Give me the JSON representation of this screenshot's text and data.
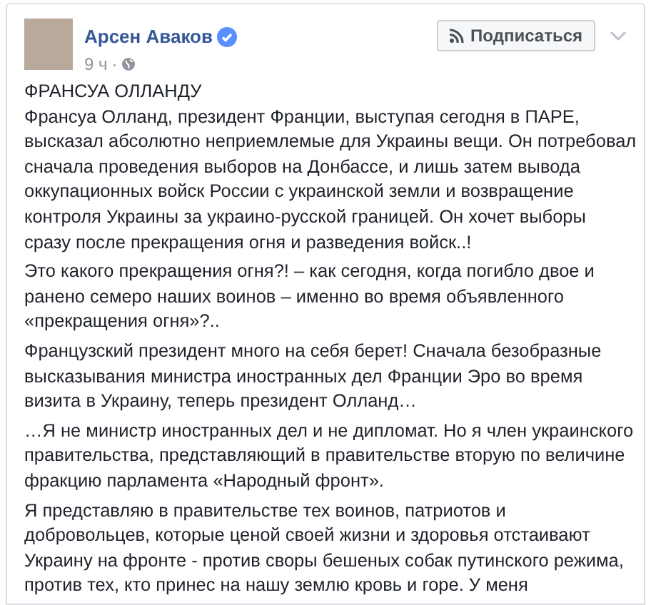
{
  "post": {
    "author": "Арсен Аваков",
    "verified": true,
    "time": "9 ч",
    "separator": "·",
    "follow_button": "Подписаться",
    "title": "ФРАНСУА ОЛЛАНДУ",
    "paragraphs": [
      "Франсуа Олланд, президент Франции, выступая сегодня в ПАРЕ, высказал абсолютно неприемлемые для Украины вещи. Он потребовал сначала проведения выборов на Донбассе, и лишь затем вывода оккупационных войск России с украинской земли и возвращение контроля Украины за украино-русской границей. Он хочет выборы сразу после прекращения огня и разведения войск..!",
      "Это какого прекращения огня?! – как сегодня, когда погибло двое и ранено семеро наших воинов – именно во время объявленного «прекращения огня»?..",
      "Французский президент много на себя берет! Сначала безобразные высказывания министра иностранных дел Франции Эро во время визита в Украину, теперь президент Олланд…",
      "…Я не министр иностранных дел и не дипломат. Но я член украинского правительства, представляющий в правительстве вторую по величине фракцию парламента «Народный фронт».",
      "Я представляю в правительстве тех воинов, патриотов и добровольцев, которые ценой своей жизни и здоровья отстаивают Украину на фронте - против своры бешеных собак путинского режима, против тех, кто принес на нашу землю кровь и горе. У меня"
    ]
  }
}
